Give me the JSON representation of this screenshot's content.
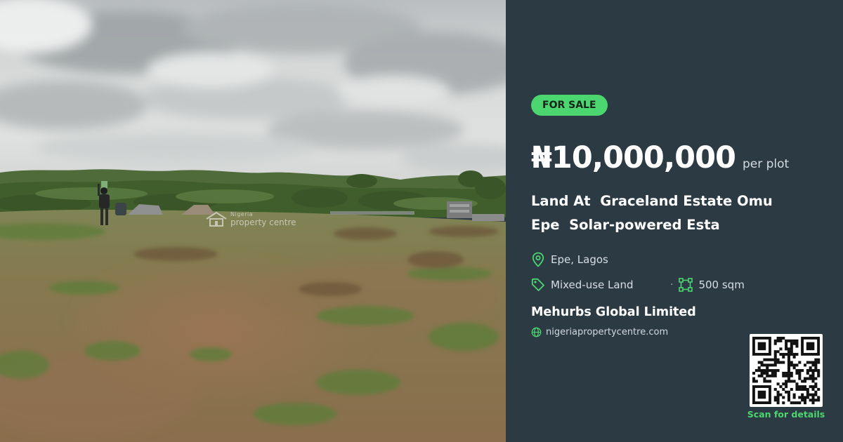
{
  "listing": {
    "badge": "FOR SALE",
    "price": "₦10,000,000",
    "price_unit": "per plot",
    "title": "Land At  Graceland Estate Omu\nEpe  Solar-powered Esta",
    "location": "Epe, Lagos",
    "property_type": "Mixed-use Land",
    "separator": "·",
    "size": "500 sqm",
    "agent": "Mehurbs Global Limited",
    "website": "nigeriapropertycentre.com",
    "scan_label": "Scan for details"
  },
  "photo": {
    "watermark_top": "Nigeria",
    "watermark_bottom": "property centre"
  },
  "icons": {
    "location": "map-pin-icon",
    "type": "tag-icon",
    "size": "area-icon",
    "website": "globe-icon",
    "qr": "qr-code"
  },
  "colors": {
    "panel_background": "#2c3a44",
    "accent_green": "#4cd66f",
    "text_primary": "#ffffff",
    "text_secondary": "#d7dee3"
  }
}
